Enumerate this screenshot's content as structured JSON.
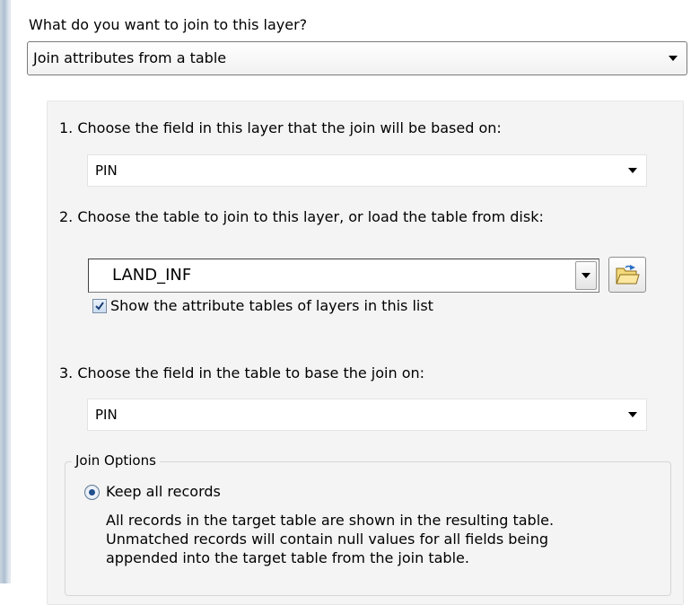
{
  "question_label": "What do you want to join to this layer?",
  "join_type": {
    "value": "Join attributes from a table"
  },
  "step1": {
    "label": "1.  Choose the field in this layer that the join will be based on:",
    "value": "PIN"
  },
  "step2": {
    "label": "2.  Choose the table to join to this layer, or load the table from disk:",
    "value": "LAND_INF",
    "show_attr_tables_label": "Show the attribute tables of layers in this list",
    "show_attr_tables_checked": true,
    "browse_icon": "open-folder-icon"
  },
  "step3": {
    "label": "3.  Choose the field in the table to base the join on:",
    "value": "PIN"
  },
  "join_options": {
    "legend": "Join Options",
    "keep_all_label": "Keep all records",
    "keep_all_selected": true,
    "keep_all_desc_1": "All records in the target table are shown in the resulting table.",
    "keep_all_desc_2": "Unmatched records will contain null values for all fields being",
    "keep_all_desc_3": "appended into the target table from the join table."
  }
}
